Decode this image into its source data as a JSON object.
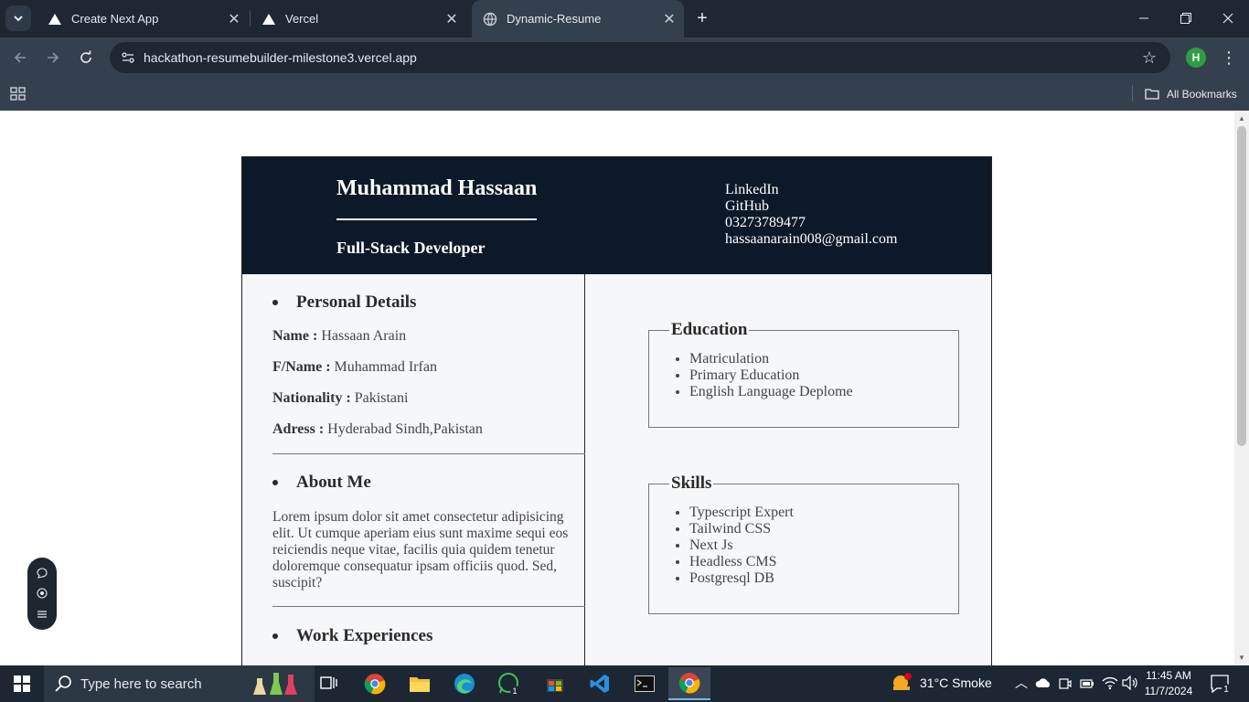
{
  "browser": {
    "tabs": [
      {
        "title": "Create Next App",
        "icon": "vercel-triangle-icon",
        "active": false
      },
      {
        "title": "Vercel",
        "icon": "vercel-triangle-icon",
        "active": false
      },
      {
        "title": "Dynamic-Resume",
        "icon": "globe-icon",
        "active": true
      }
    ],
    "url": "hackathon-resumebuilder-milestone3.vercel.app",
    "profile_initial": "H",
    "all_bookmarks": "All Bookmarks"
  },
  "resume": {
    "name": "Muhammad Hassaan",
    "role": "Full-Stack Developer",
    "contacts": [
      "LinkedIn",
      "GitHub",
      "03273789477",
      "hassaanarain008@gmail.com"
    ],
    "personal": {
      "title": "Personal Details",
      "fields": [
        {
          "label": "Name :",
          "value": "Hassaan Arain"
        },
        {
          "label": "F/Name :",
          "value": "Muhammad Irfan"
        },
        {
          "label": "Nationality :",
          "value": "Pakistani"
        },
        {
          "label": "Adress :",
          "value": "Hyderabad Sindh,Pakistan"
        }
      ]
    },
    "about": {
      "title": "About Me",
      "text": "Lorem ipsum dolor sit amet consectetur adipisicing elit. Ut cumque aperiam eius sunt maxime sequi eos reiciendis neque vitae, facilis quia quidem tenetur doloremque consequatur ipsam officiis quod. Sed, suscipit?"
    },
    "work": {
      "title": "Work Experiences"
    },
    "education": {
      "title": "Education",
      "items": [
        "Matriculation",
        "Primary Education",
        "English Language Deplome"
      ]
    },
    "skills": {
      "title": "Skills",
      "items": [
        "Typescript Expert",
        "Tailwind CSS",
        "Next Js",
        "Headless CMS",
        "Postgresql DB"
      ]
    }
  },
  "taskbar": {
    "search_placeholder": "Type here to search",
    "weather": "31°C  Smoke",
    "time": "11:45 AM",
    "date": "11/7/2024",
    "notifications": "1",
    "whatsapp_badge": "1"
  },
  "colors": {
    "tabbar": "#1f2733",
    "toolbar": "#35404f",
    "resume_header": "#0c1929",
    "resume_body": "#f6f7f9",
    "profile_avatar": "#2e9d44"
  }
}
